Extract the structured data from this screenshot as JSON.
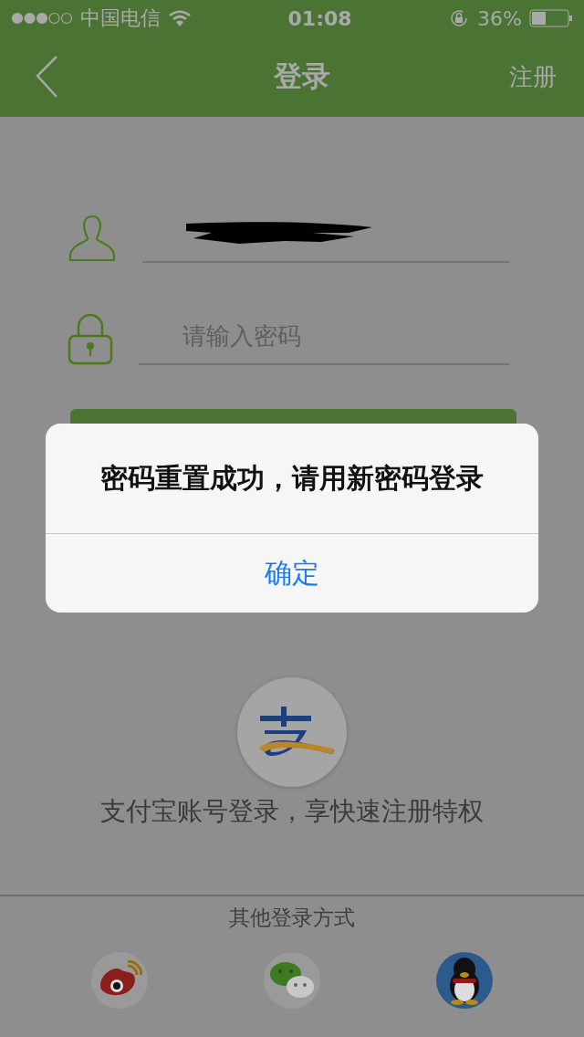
{
  "status_bar": {
    "carrier": "中国电信",
    "time": "01:08",
    "battery": "36%"
  },
  "nav": {
    "title": "登录",
    "action": "注册"
  },
  "password_field": {
    "placeholder": "请输入密码"
  },
  "alipay": {
    "caption": "支付宝账号登录，享快速注册特权"
  },
  "other_login": {
    "title": "其他登录方式"
  },
  "alert": {
    "message": "密码重置成功，请用新密码登录",
    "button": "确定"
  }
}
